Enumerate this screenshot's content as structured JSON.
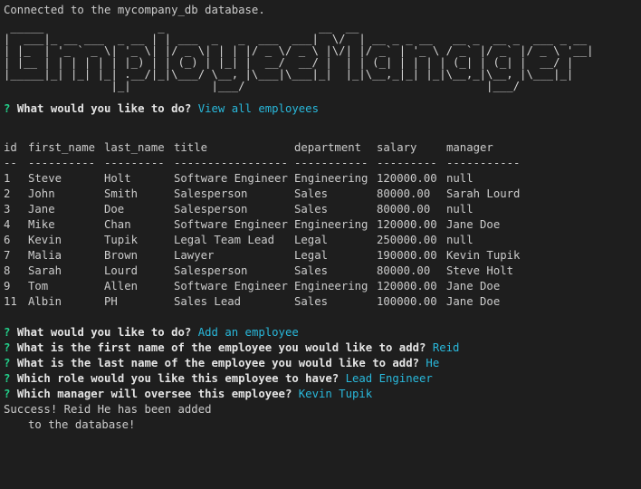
{
  "status_line": "Connected to the mycompany_db database.",
  "banner_art": [
    " _____                 _                       __  __",
    "|  ___|_ __ ___  _ __ | | ___  _   _  ___  ___|  \\/  | __ _ _ __   __ _  __ _  ___ _ __",
    "| |_  | '_ ` _ \\| '_ \\| |/ _ \\| | | |/ _ \\/ _ \\ |\\/| |/ _` | '_ \\ / _` |/ _` |/ _ \\ '__|",
    "| |__ | | | | | | |_) | | (_) | |_| |  __/  __/ |  | | (_| | | | | (_| | (_| |  __/ |",
    "|_____|_| |_| |_| .__/|_|\\___/ \\__, |\\___|\\___|_|  |_|\\__,_|_| |_|\\__,_|\\__, |\\___|_|",
    "                |_|            |___/                                    |___/"
  ],
  "prompt_marker": "?",
  "prompt1": {
    "question": "What would you like to do?",
    "answer": "View all employees"
  },
  "table": {
    "headers": [
      "id",
      "first_name",
      "last_name",
      "title",
      "department",
      "salary",
      "manager"
    ],
    "dividers": [
      "--",
      "----------",
      "---------",
      "-----------------",
      "-----------",
      "---------",
      "-----------"
    ],
    "rows": [
      [
        "1",
        "Steve",
        "Holt",
        "Software Engineer",
        "Engineering",
        "120000.00",
        "null"
      ],
      [
        "2",
        "John",
        "Smith",
        "Salesperson",
        "Sales",
        "80000.00",
        "Sarah Lourd"
      ],
      [
        "3",
        "Jane",
        "Doe",
        "Salesperson",
        "Sales",
        "80000.00",
        "null"
      ],
      [
        "4",
        "Mike",
        "Chan",
        "Software Engineer",
        "Engineering",
        "120000.00",
        "Jane Doe"
      ],
      [
        "6",
        "Kevin",
        "Tupik",
        "Legal Team Lead",
        "Legal",
        "250000.00",
        "null"
      ],
      [
        "7",
        "Malia",
        "Brown",
        "Lawyer",
        "Legal",
        "190000.00",
        "Kevin Tupik"
      ],
      [
        "8",
        "Sarah",
        "Lourd",
        "Salesperson",
        "Sales",
        "80000.00",
        "Steve Holt"
      ],
      [
        "9",
        "Tom",
        "Allen",
        "Software Engineer",
        "Engineering",
        "120000.00",
        "Jane Doe"
      ],
      [
        "11",
        "Albin",
        "PH",
        "Sales Lead",
        "Sales",
        "100000.00",
        "Jane Doe"
      ]
    ]
  },
  "prompts2": [
    {
      "question": "What would you like to do?",
      "answer": "Add an employee"
    },
    {
      "question": "What is the first name of the employee you would like to add?",
      "answer": "Reid"
    },
    {
      "question": "What is the last name of the employee you would like to add?",
      "answer": "He"
    },
    {
      "question": "Which role would you like this employee to have?",
      "answer": "Lead Engineer"
    },
    {
      "question": "Which manager will oversee this employee?",
      "answer": "Kevin Tupik"
    }
  ],
  "success_line1": "Success! Reid He has been added",
  "success_line2": "to the database!",
  "colors": {
    "background": "#1e1e1e",
    "text": "#cccccc",
    "prompt_marker": "#23d18b",
    "answer": "#29b8db"
  }
}
